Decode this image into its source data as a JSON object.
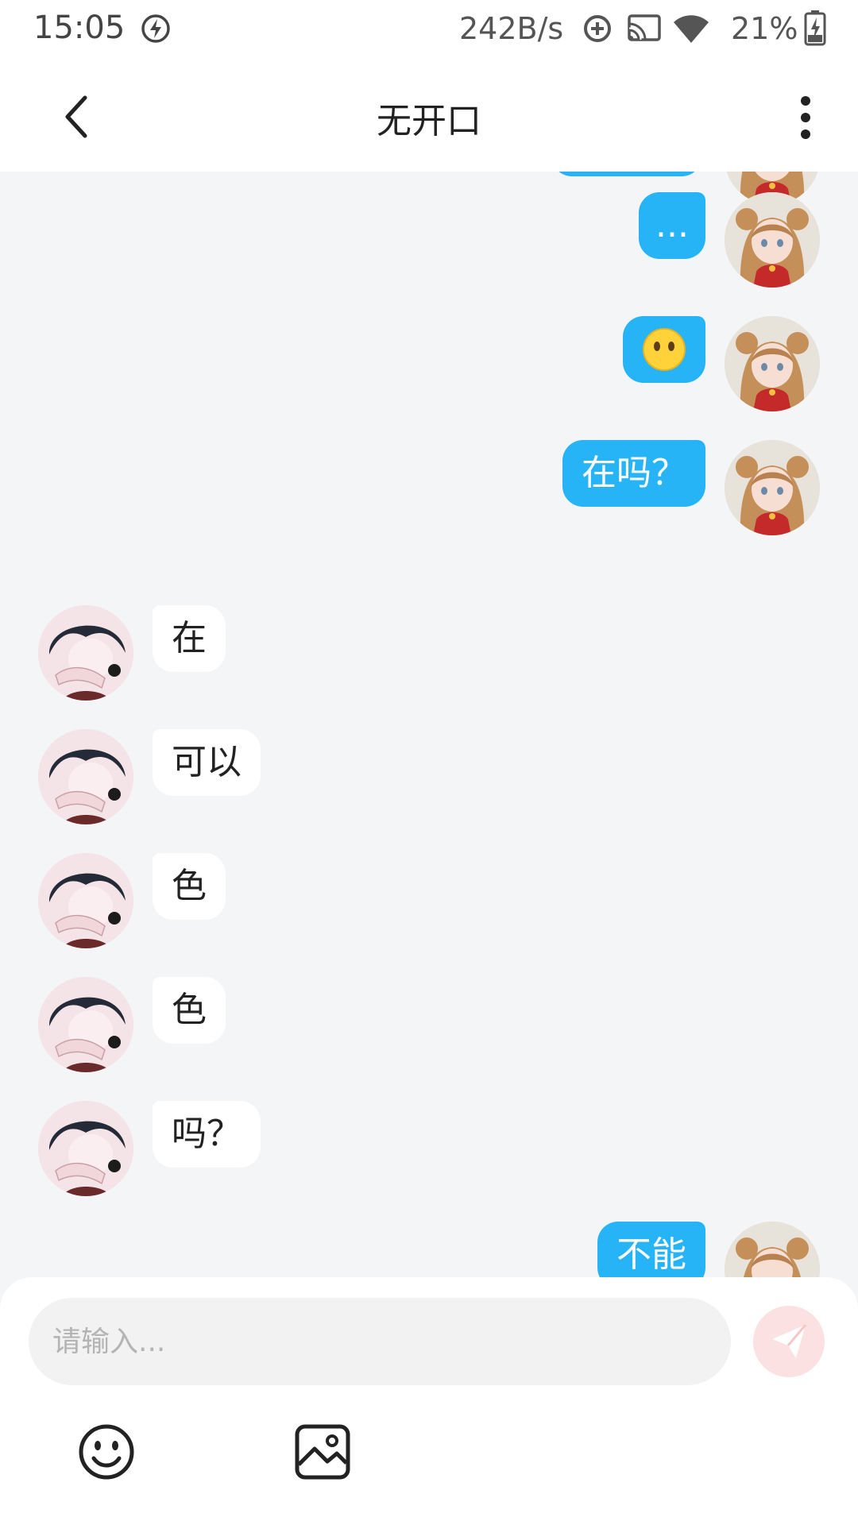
{
  "status_bar": {
    "time": "15:05",
    "net_speed": "242B/s",
    "battery_percent": "21%",
    "icons": [
      "flash-icon",
      "sync-icon",
      "cast-icon",
      "wifi-icon",
      "battery-icon"
    ]
  },
  "header": {
    "title": "无开口",
    "icons": [
      "back-arrow-icon",
      "more-vertical-icon"
    ]
  },
  "messages": [
    {
      "side": "right",
      "text": "",
      "partial": true
    },
    {
      "side": "right",
      "text": "..."
    },
    {
      "side": "right",
      "type": "emoji",
      "emoji": "neutral-face-no-mouth"
    },
    {
      "side": "right",
      "text": "在吗？"
    },
    {
      "side": "left",
      "text": "在"
    },
    {
      "side": "left",
      "text": "可以"
    },
    {
      "side": "left",
      "text": "色"
    },
    {
      "side": "left",
      "text": "色"
    },
    {
      "side": "left",
      "text": "吗？"
    },
    {
      "side": "right",
      "text": "不能",
      "partial": true
    }
  ],
  "input": {
    "placeholder": "请输入...",
    "value": ""
  },
  "toolbar": {
    "icons": [
      "send-icon",
      "emoji-icon",
      "image-icon"
    ]
  },
  "colors": {
    "outgoing_bubble": "#27b4f6",
    "incoming_bubble": "#ffffff",
    "chat_background": "#f4f5f7",
    "send_button": "#fbe1e1"
  }
}
